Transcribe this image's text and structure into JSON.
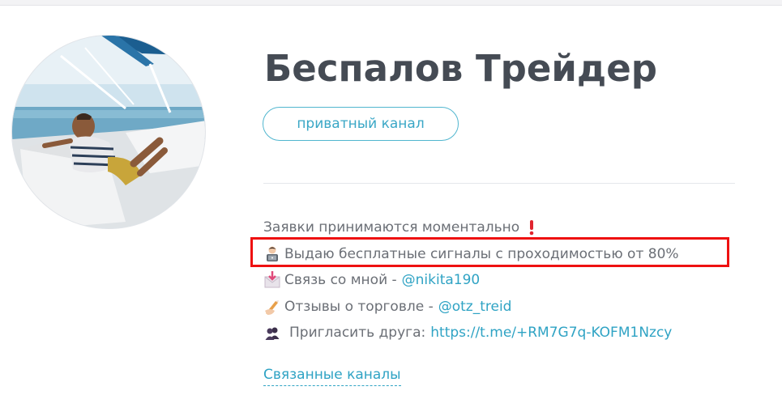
{
  "channel": {
    "title": "Беспалов Трейдер",
    "badge": "приватный канал"
  },
  "description": {
    "line1": {
      "text": "Заявки принимаются моментально",
      "icon": "exclamation-icon"
    },
    "line2": {
      "text": "Выдаю бесплатные сигналы с проходимостью от 80%",
      "icon": "technologist-icon"
    },
    "line3": {
      "text": "Связь со мной -",
      "link": "@nikita190",
      "icon": "envelope-icon"
    },
    "line4": {
      "text": "Отзывы о торговле -",
      "link": "@otz_treid",
      "icon": "writing-hand-icon"
    },
    "line5": {
      "text": "Пригласить друга:",
      "link": "https://t.me/+RM7G7q-KOFM1Nzcy",
      "icon": "people-icon"
    }
  },
  "related_channels_label": "Связанные каналы",
  "colors": {
    "title": "#454b54",
    "accent": "#2fa3c4",
    "highlight": "#ee1111",
    "body_text": "#6b6f76"
  }
}
